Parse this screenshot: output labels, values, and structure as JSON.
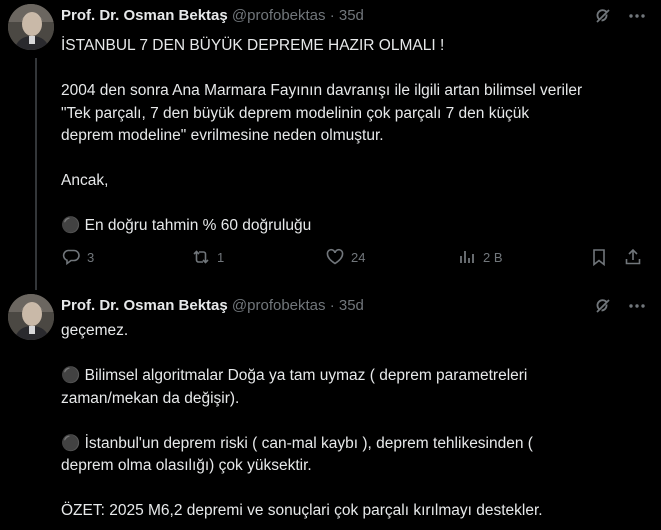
{
  "tweet1": {
    "author_name": "Prof. Dr. Osman Bektaş",
    "handle": "@profobektas",
    "separator": "·",
    "time": "35d",
    "lines": [
      "İSTANBUL 7 DEN BÜYÜK DEPREME HAZIR OLMALI !",
      "",
      "2004 den sonra Ana Marmara Fayının davranışı ile ilgili artan bilimsel veriler",
      "\"Tek parçalı, 7 den büyük deprem modelinin çok parçalı 7 den küçük",
      "deprem modeline\" evrilmesine neden olmuştur.",
      "",
      "Ancak,",
      "",
      "⚫ En doğru tahmin % 60 doğruluğu"
    ],
    "actions": {
      "replies": "3",
      "reposts": "1",
      "likes": "24",
      "views": "2 B"
    }
  },
  "tweet2": {
    "author_name": "Prof. Dr. Osman Bektaş",
    "handle": "@profobektas",
    "separator": "·",
    "time": "35d",
    "lines": [
      "geçemez.",
      "",
      "⚫ Bilimsel algoritmalar Doğa ya tam uymaz ( deprem parametreleri",
      "zaman/mekan da değişir).",
      "",
      "⚫ İstanbul'un deprem riski ( can-mal kaybı ), deprem tehlikesinden (",
      "deprem olma olasılığı) çok yüksektir.",
      "",
      "ÖZET: 2025 M6,2 depremi ve sonuçlari çok parçalı kırılmayı destekler."
    ]
  },
  "icons": {
    "grok": "grok-icon",
    "more": "more-icon",
    "reply": "reply-icon",
    "repost": "repost-icon",
    "like": "like-icon",
    "views": "views-icon",
    "bookmark": "bookmark-icon",
    "share": "share-icon"
  },
  "colors": {
    "background": "#000000",
    "text": "#e7e9ea",
    "muted": "#71767b",
    "thread_line": "#333639"
  }
}
